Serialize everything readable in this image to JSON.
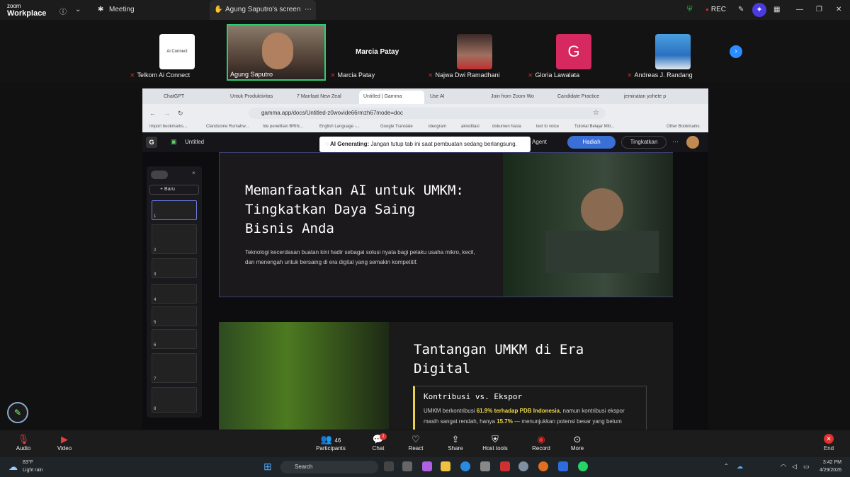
{
  "zoom": {
    "logo_line1": "zoom",
    "logo_line2": "Workplace",
    "meeting_label": "Meeting",
    "share_title": "Agung Saputro's screen",
    "rec_label": "REC"
  },
  "participants": [
    {
      "name": "Telkom Ai Connect",
      "tile_text": "Ai Connect"
    },
    {
      "name": "Agung Saputro",
      "tile_text": ""
    },
    {
      "name": "Marcia Patay",
      "tile_text": "Marcia Patay"
    },
    {
      "name": "Najwa Dwi Ramadhani",
      "tile_text": ""
    },
    {
      "name": "Gloria Lawalata",
      "tile_text": "G"
    },
    {
      "name": "Andreas J. Randang",
      "tile_text": ""
    }
  ],
  "browser": {
    "tabs": [
      "ChatGPT",
      "Untuk Produktivitas",
      "7 Manfaat New Zeal",
      "Untitled | Gamma",
      "Use AI",
      "Join from Zoom Wo",
      "Candidate Practice",
      "jeminatan yohete p"
    ],
    "url": "gamma.app/docs/Untitled-z0wovide66rmzh67mode=doc",
    "bookmarks": [
      "Import bookmarks...",
      "Clandstone Rumahw...",
      "Ide penelitian BRIN...",
      "English Language -...",
      "Google Translate",
      "ideogram",
      "akreditasi",
      "dokumen hasla",
      "text to voice",
      "Tutorial Belajar Mitr...",
      "Other Bookmarks"
    ]
  },
  "gamma": {
    "doc_title": "Untitled",
    "agent_label": "Agent",
    "present_label": "Hadiah",
    "upgrade_label": "Tingkatkan",
    "generating_bold": "AI Generating:",
    "generating_text": "Jangan tutup tab ini saat pembuatan sedang berlangsung.",
    "new_label": "Baru",
    "slide_numbers": [
      "1",
      "2",
      "3",
      "4",
      "5",
      "6",
      "7",
      "8"
    ],
    "card1_title": "Memanfaatkan AI untuk UMKM: Tingkatkan Daya Saing Bisnis Anda",
    "card1_text": "Teknologi kecerdasan buatan kini hadir sebagai solusi nyata bagi pelaku usaha mikro, kecil, dan menengah untuk bersaing di era digital yang semakin kompetitif.",
    "card2_title": "Tantangan UMKM di Era Digital",
    "quote_title": "Kontribusi vs. Ekspor",
    "quote_pre": "UMKM berkontribusi ",
    "quote_bold1": "61.9% terhadap PDB Indonesia",
    "quote_mid": ", namun kontribusi ekspor masih sangat rendah, hanya ",
    "quote_bold2": "15.7%",
    "quote_post": " — menunjukkan potensi besar yang belum"
  },
  "controls": {
    "audio": "Audio",
    "video": "Video",
    "participants": "Participants",
    "participants_count": "46",
    "chat": "Chat",
    "chat_badge": "1",
    "react": "React",
    "share": "Share",
    "host_tools": "Host tools",
    "record": "Record",
    "more": "More",
    "end": "End"
  },
  "taskbar": {
    "temp": "83°F",
    "weather": "Light rain",
    "search": "Search",
    "time": "3:42 PM",
    "date": "4/29/2026"
  }
}
